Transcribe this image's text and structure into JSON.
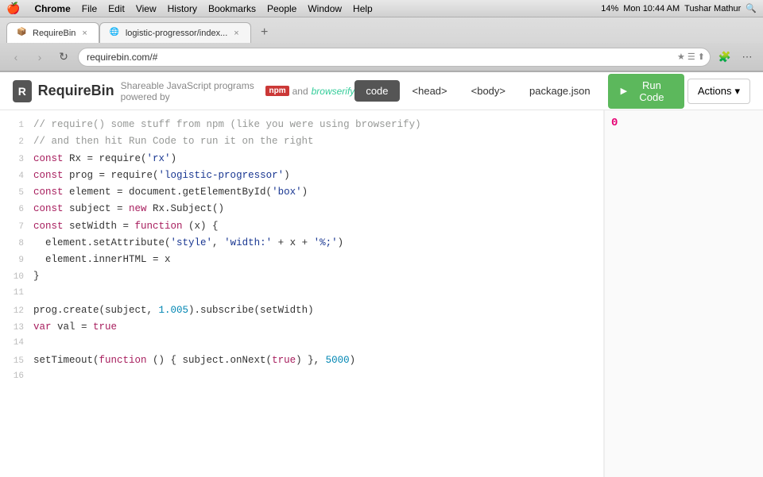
{
  "os": {
    "apple": "🍎",
    "menu_items": [
      "Chrome",
      "File",
      "Edit",
      "View",
      "History",
      "Bookmarks",
      "People",
      "Window",
      "Help"
    ],
    "right_items": [
      "14%",
      "Mon 10:44 AM",
      "Tushar Mathur"
    ],
    "search_icon": "🔍"
  },
  "browser": {
    "tabs": [
      {
        "id": "tab-requirebin",
        "title": "RequireBin",
        "favicon": "📦",
        "active": true
      },
      {
        "id": "tab-logistic",
        "title": "logistic-progressor/index...",
        "favicon": "🌐",
        "active": false
      }
    ],
    "url": "requirebin.com/#",
    "nav": {
      "back": "‹",
      "forward": "›",
      "refresh": "↻"
    }
  },
  "requirebin": {
    "logo_icon": "📦",
    "logo_text": "RequireBin",
    "subtitle_prefix": "Shareable JavaScript programs powered by",
    "npm_label": "npm",
    "and": "and",
    "browserify": "browserify",
    "tabs": [
      {
        "id": "code",
        "label": "code",
        "active": true
      },
      {
        "id": "head",
        "label": "<head>",
        "active": false
      },
      {
        "id": "body",
        "label": "<body>",
        "active": false
      },
      {
        "id": "package",
        "label": "package.json",
        "active": false
      }
    ],
    "run_button": "Run Code",
    "actions_button": "Actions"
  },
  "code": {
    "lines": [
      {
        "num": 1,
        "content": "// require() some stuff from npm (like you were using browserify)",
        "type": "comment"
      },
      {
        "num": 2,
        "content": "// and then hit Run Code to run it on the right",
        "type": "comment"
      },
      {
        "num": 3,
        "content": "const Rx = require('rx')",
        "type": "code"
      },
      {
        "num": 4,
        "content": "const prog = require('logistic-progressor')",
        "type": "code"
      },
      {
        "num": 5,
        "content": "const element = document.getElementById('box')",
        "type": "code"
      },
      {
        "num": 6,
        "content": "const subject = new Rx.Subject()",
        "type": "code"
      },
      {
        "num": 7,
        "content": "const setWidth = function (x) {",
        "type": "code"
      },
      {
        "num": 8,
        "content": "  element.setAttribute('style', 'width:' + x + '%;')",
        "type": "code"
      },
      {
        "num": 9,
        "content": "  element.innerHTML = x",
        "type": "code"
      },
      {
        "num": 10,
        "content": "}",
        "type": "code"
      },
      {
        "num": 11,
        "content": "",
        "type": "code"
      },
      {
        "num": 12,
        "content": "prog.create(subject, 1.005).subscribe(setWidth)",
        "type": "code"
      },
      {
        "num": 13,
        "content": "var val = true",
        "type": "code"
      },
      {
        "num": 14,
        "content": "",
        "type": "code"
      },
      {
        "num": 15,
        "content": "setTimeout(function () { subject.onNext(true) }, 5000)",
        "type": "code"
      },
      {
        "num": 16,
        "content": "",
        "type": "code"
      }
    ],
    "output": "0"
  }
}
